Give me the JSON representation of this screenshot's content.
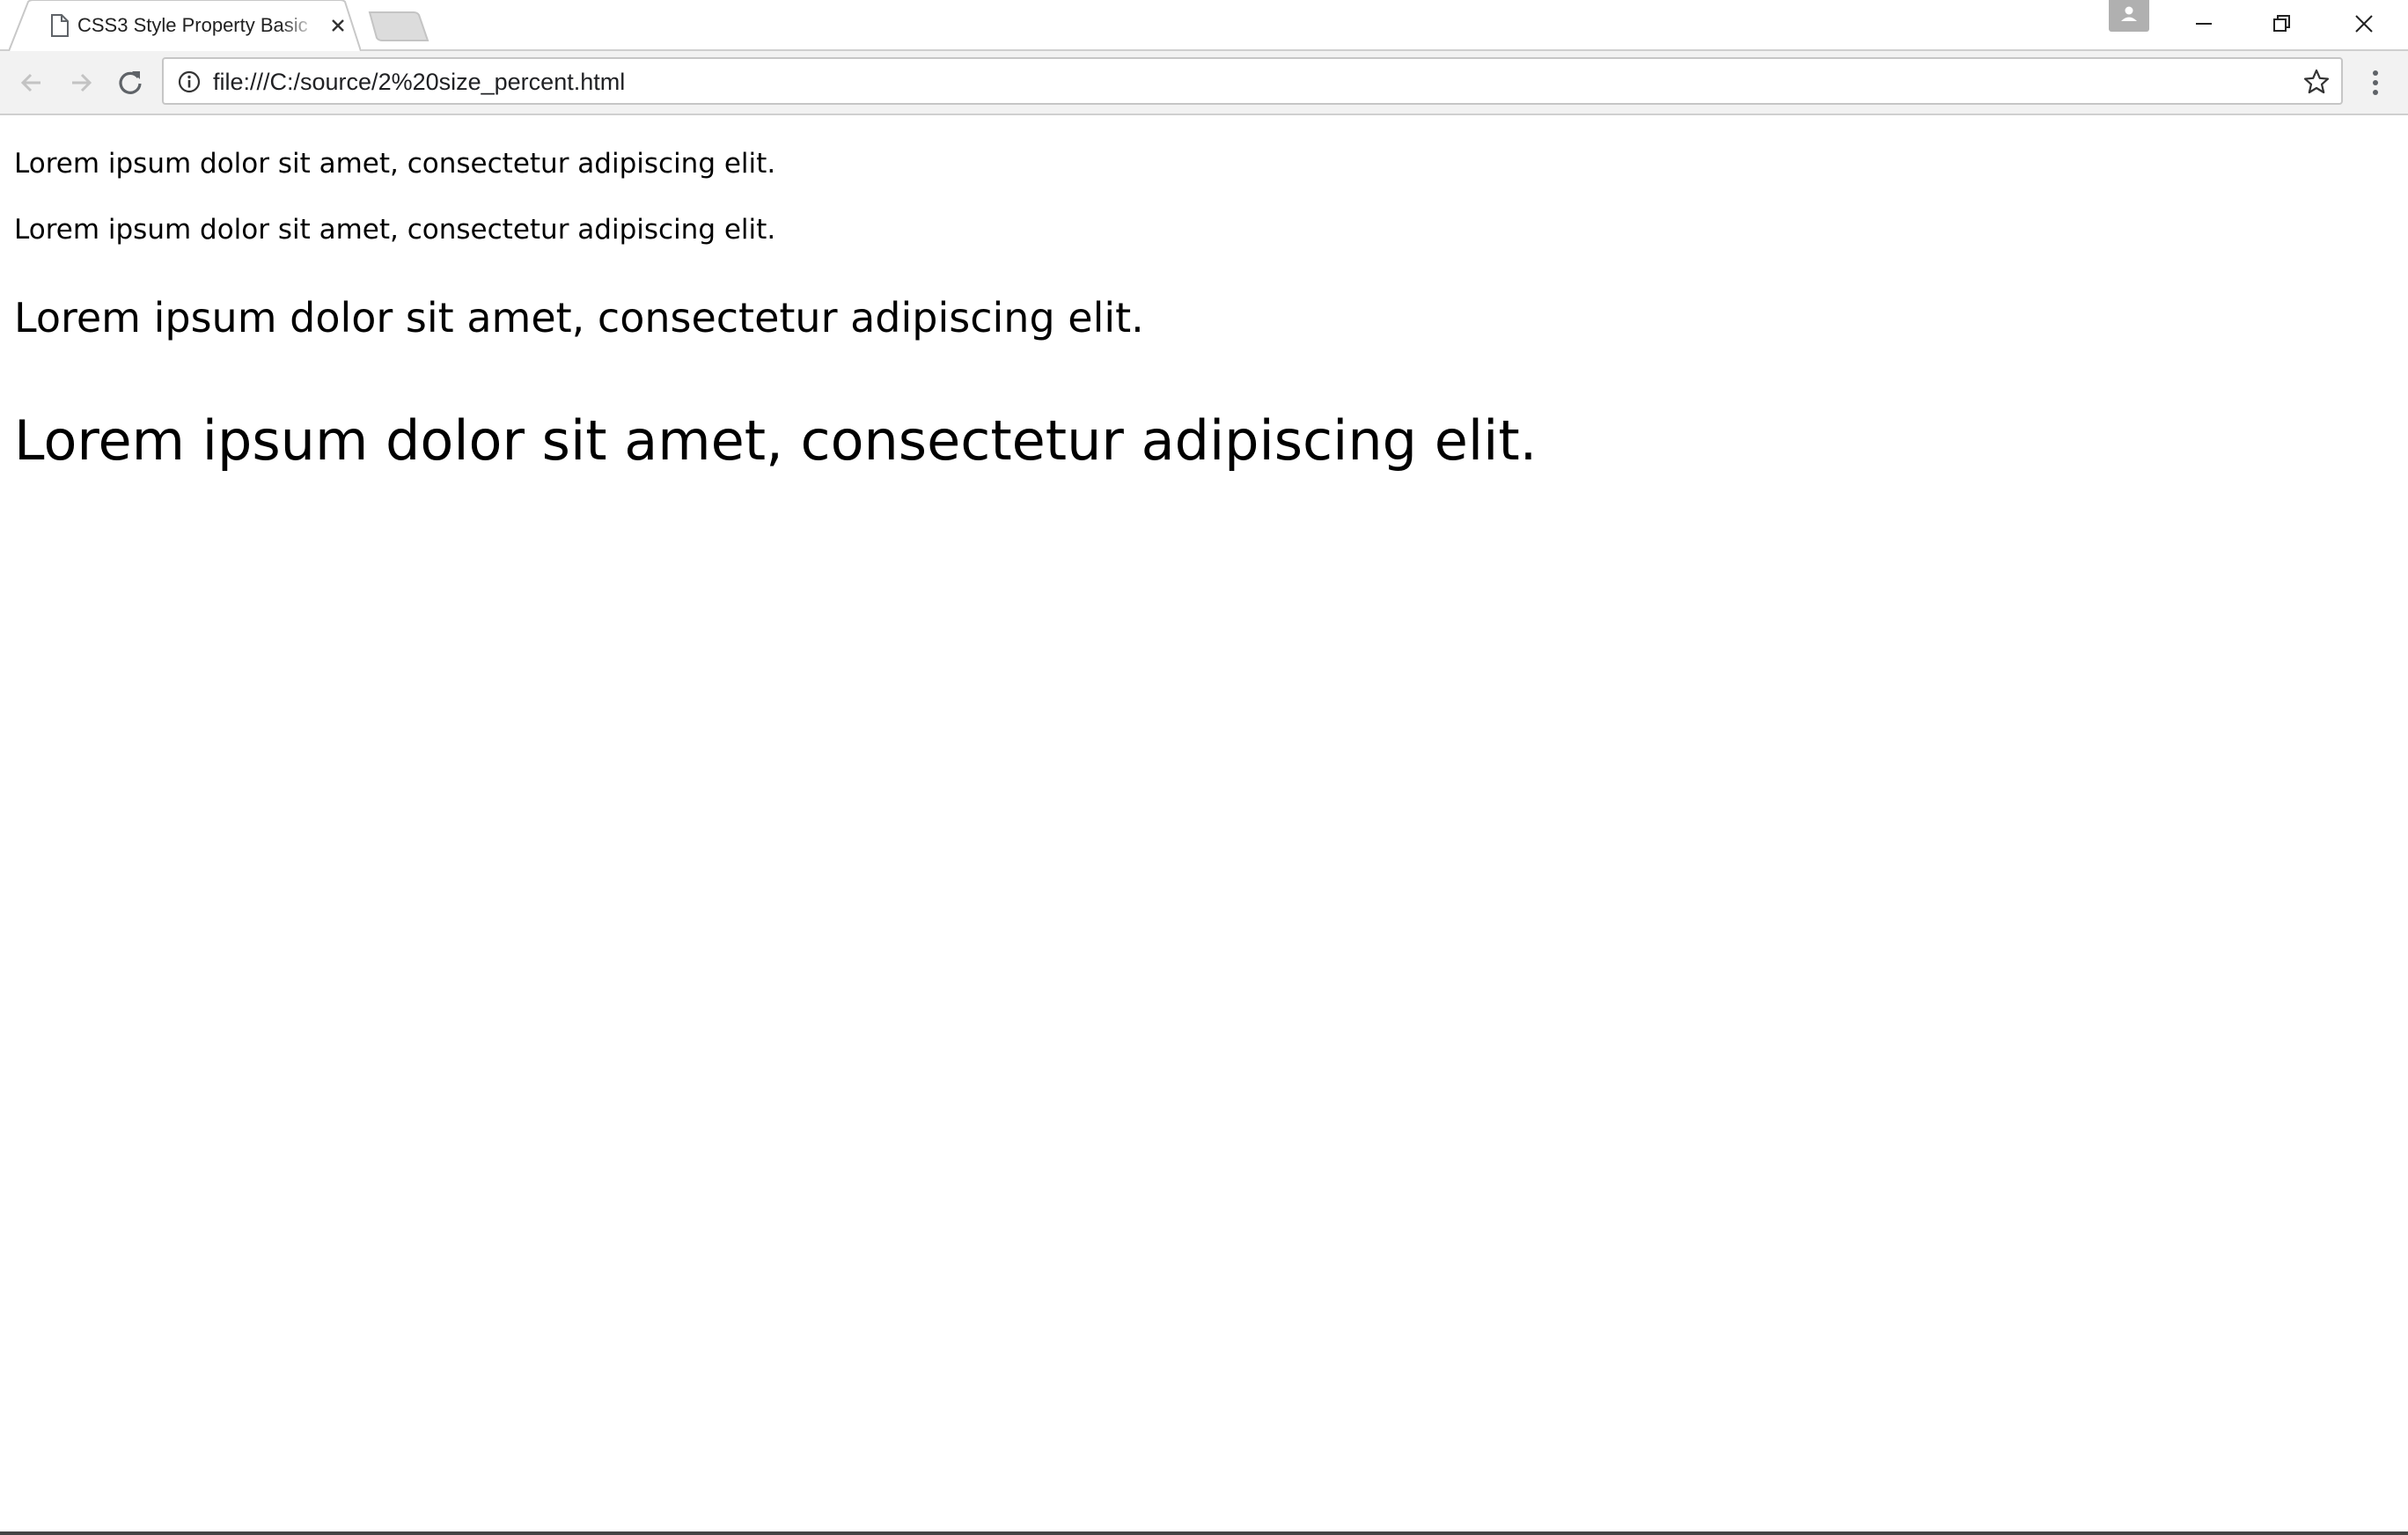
{
  "browser": {
    "tab": {
      "title": "CSS3 Style Property Basic",
      "favicon_icon": "page-icon",
      "close_icon": "close-icon"
    },
    "new_tab_icon": "new-tab-icon",
    "profile_icon": "person-icon",
    "window_controls": [
      "minimize-icon",
      "restore-icon",
      "close-icon"
    ],
    "nav": {
      "back_icon": "arrow-left-icon",
      "forward_icon": "arrow-right-icon",
      "reload_icon": "reload-icon"
    },
    "address_bar": {
      "url": "file:///C:/source/2%20size_percent.html",
      "info_icon": "info-icon",
      "bookmark_icon": "star-icon"
    },
    "menu_icon": "kebab-menu-icon"
  },
  "page": {
    "lines": [
      "Lorem ipsum dolor sit amet, consectetur adipiscing elit.",
      "Lorem ipsum dolor sit amet, consectetur adipiscing elit.",
      "Lorem ipsum dolor sit amet, consectetur adipiscing elit.",
      "Lorem ipsum dolor sit amet, consectetur adipiscing elit."
    ]
  }
}
